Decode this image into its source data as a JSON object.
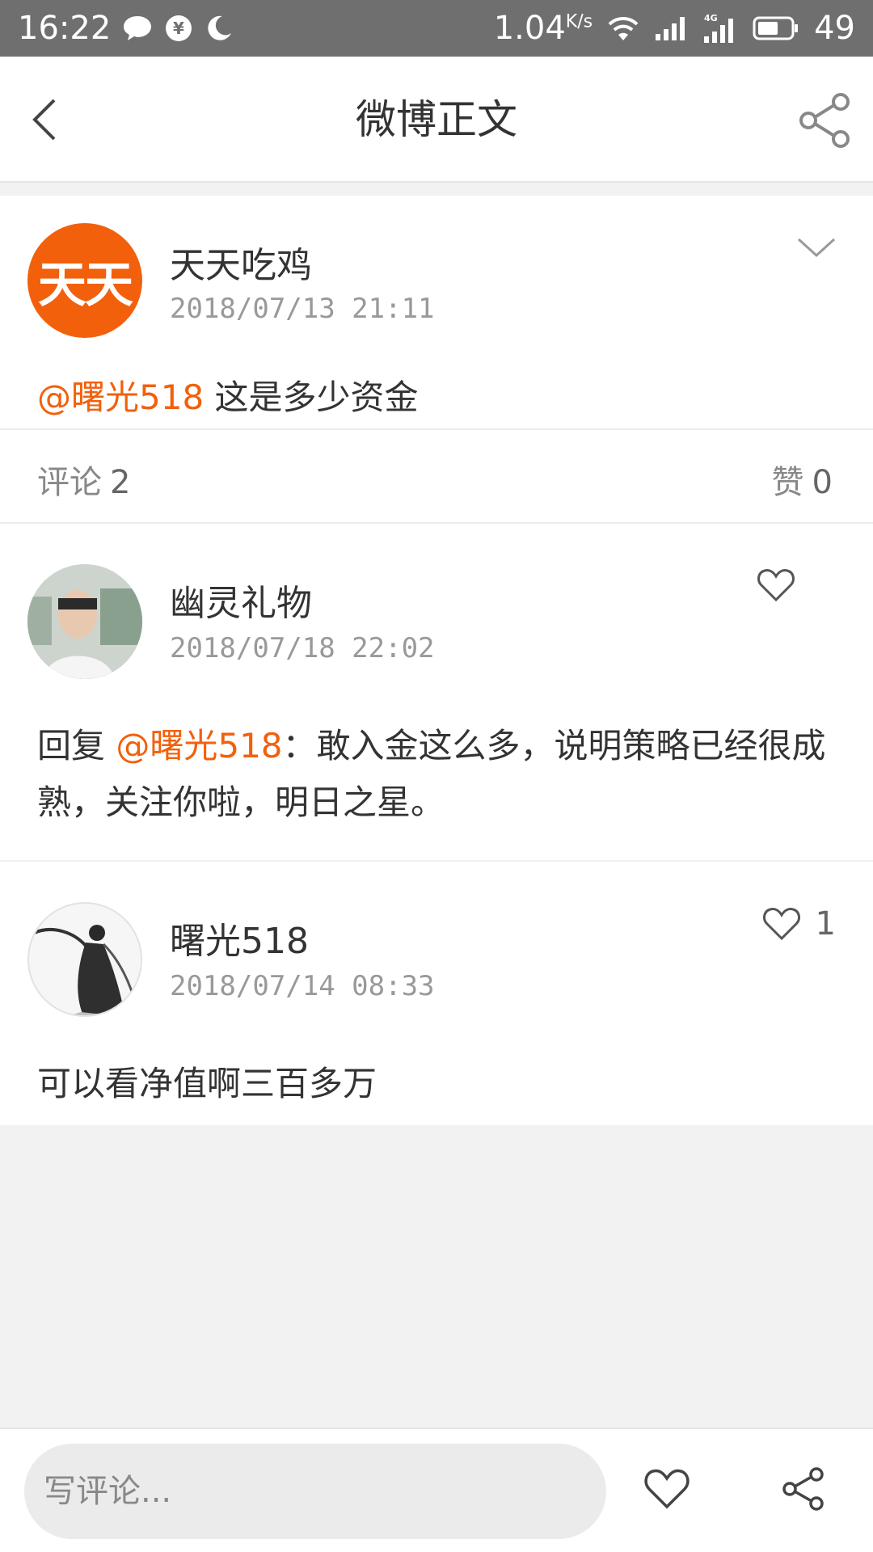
{
  "status_bar": {
    "time": "16:22",
    "speed": "1.04",
    "speed_unit": "K/s",
    "network": "4G",
    "battery": "49",
    "icons": [
      "chat-bubble-icon",
      "yen-icon",
      "moon-icon",
      "wifi-icon",
      "signal-icon",
      "4g-signal-icon",
      "battery-icon"
    ]
  },
  "header": {
    "title": "微博正文",
    "back_icon": "back-chevron-icon",
    "share_icon": "share-icon"
  },
  "post": {
    "avatar_text": "天天",
    "author": "天天吃鸡",
    "time": "2018/07/13 21:11",
    "mention": "@曙光518",
    "text": " 这是多少资金"
  },
  "counts": {
    "comments_label": "评论",
    "comments_value": "2",
    "likes_label": "赞",
    "likes_value": "0"
  },
  "comments": [
    {
      "author": "幽灵礼物",
      "time": "2018/07/18 22:02",
      "prefix": "回复 ",
      "mention": "@曙光518",
      "text": "：敢入金这么多，说明策略已经很成熟，关注你啦，明日之星。",
      "likes": ""
    },
    {
      "author": "曙光518",
      "time": "2018/07/14 08:33",
      "text": "可以看净值啊三百多万",
      "likes": "1"
    }
  ],
  "bottom_bar": {
    "input_placeholder": "写评论...",
    "like_icon": "heart-icon",
    "share_icon": "share-icon"
  },
  "colors": {
    "accent": "#f2600c",
    "status_bar": "#6f6f6f",
    "background": "#f2f2f2"
  }
}
